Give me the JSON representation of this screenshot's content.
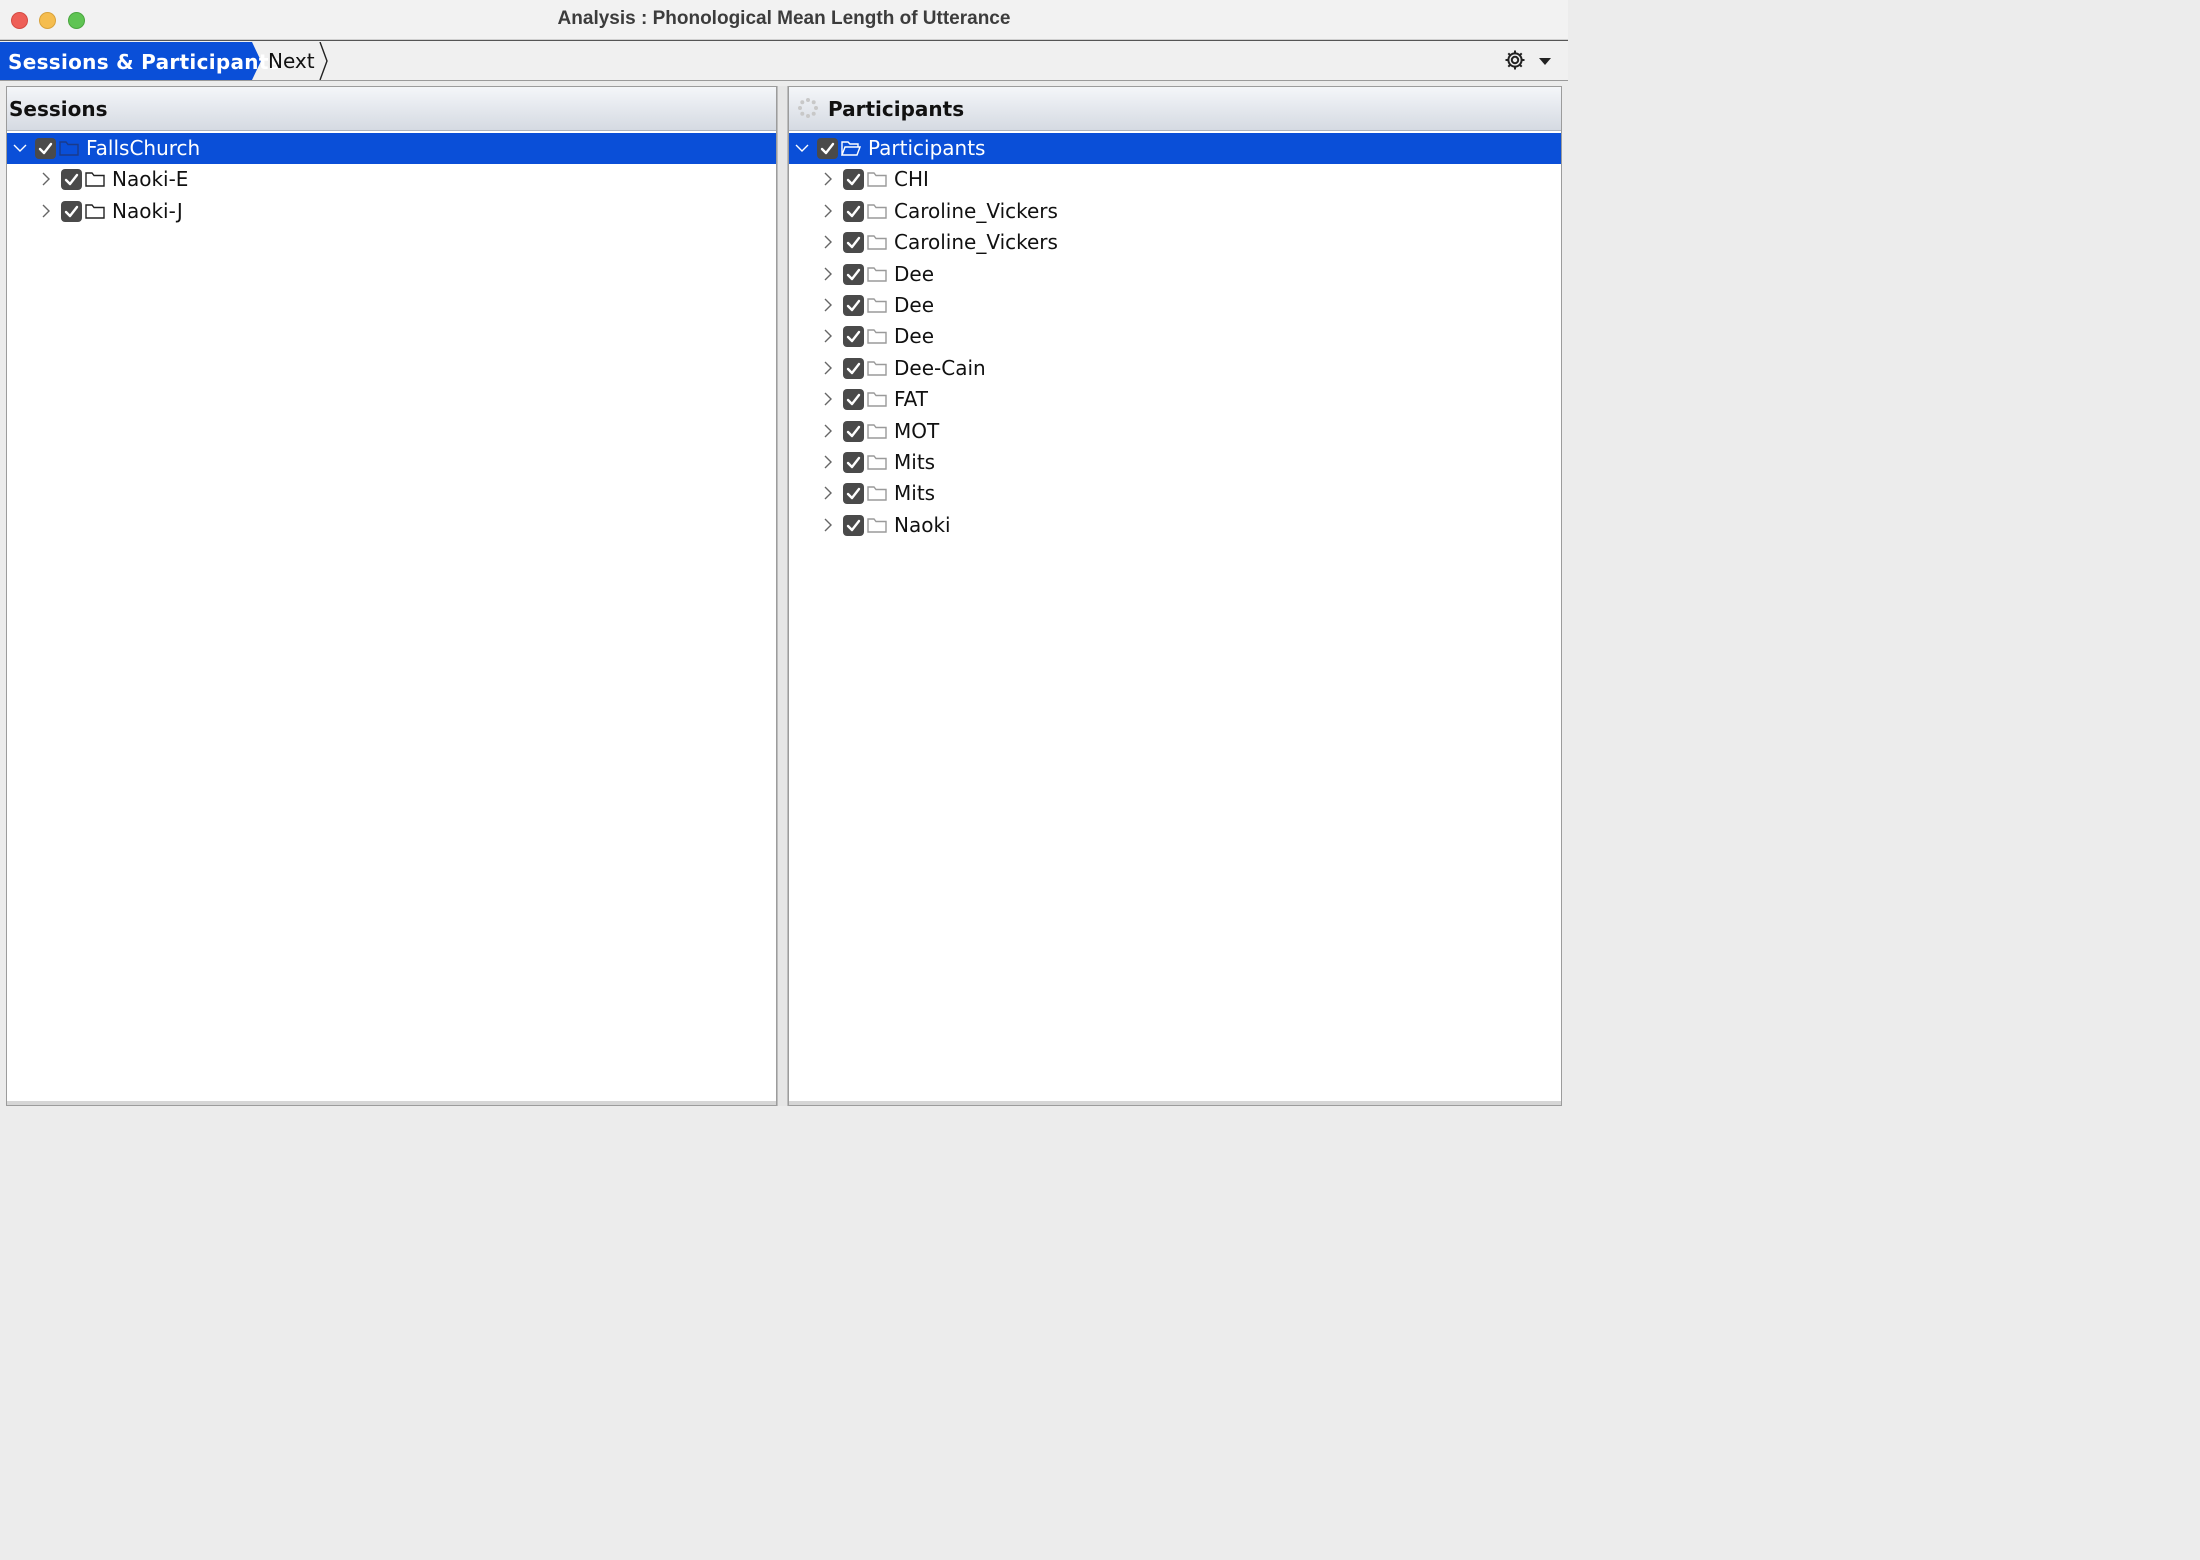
{
  "window": {
    "title": "Analysis : Phonological Mean Length of Utterance"
  },
  "toolbar": {
    "active_step": "Sessions & Participants",
    "next_step": "Next",
    "settings_icon": "gear-icon",
    "menu_icon": "caret-down-icon"
  },
  "sessions": {
    "header": "Sessions",
    "root": {
      "label": "FallsChurch",
      "checked": true,
      "expanded": true,
      "selected": true
    },
    "children": [
      {
        "label": "Naoki-E",
        "checked": true
      },
      {
        "label": "Naoki-J",
        "checked": true
      }
    ]
  },
  "participants": {
    "header": "Participants",
    "root": {
      "label": "Participants",
      "checked": true,
      "expanded": true,
      "selected": true
    },
    "children": [
      {
        "label": "CHI",
        "checked": true
      },
      {
        "label": "Caroline_Vickers",
        "checked": true
      },
      {
        "label": "Caroline_Vickers",
        "checked": true
      },
      {
        "label": "Dee",
        "checked": true
      },
      {
        "label": "Dee",
        "checked": true
      },
      {
        "label": "Dee",
        "checked": true
      },
      {
        "label": "Dee-Cain",
        "checked": true
      },
      {
        "label": "FAT",
        "checked": true
      },
      {
        "label": "MOT",
        "checked": true
      },
      {
        "label": "Mits",
        "checked": true
      },
      {
        "label": "Mits",
        "checked": true
      },
      {
        "label": "Naoki",
        "checked": true
      }
    ]
  },
  "colors": {
    "selection": "#0a4fd8",
    "checkbox": "#4a4a4a"
  }
}
